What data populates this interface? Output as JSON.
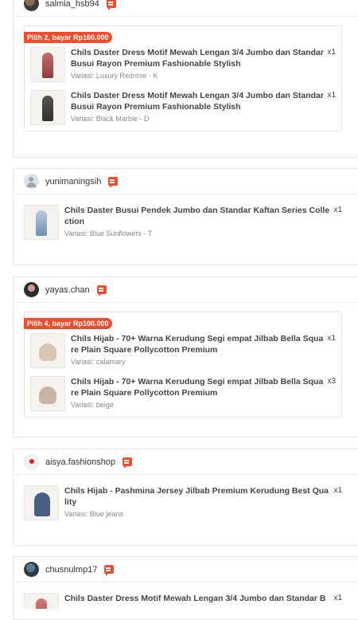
{
  "orders": [
    {
      "username": "salmia_hsb94",
      "promo": "Pilih 2, bayar Rp160.000",
      "items": [
        {
          "name": "Chils Daster Dress Motif Mewah Lengan 3/4 Jumbo dan Standar Busui Rayon Premium Fashionable Stylish",
          "variant": "Variasi: Luxury Redrose - K",
          "qty": "x1"
        },
        {
          "name": "Chils Daster Dress Motif Mewah Lengan 3/4 Jumbo dan Standar Busui Rayon Premium Fashionable Stylish",
          "variant": "Variasi: Black Marble - D",
          "qty": "x1"
        }
      ]
    },
    {
      "username": "yunimaningsih",
      "items": [
        {
          "name": "Chils Daster Busui Pendek Jumbo dan Standar Kaftan Series Collection",
          "variant": "Variasi: Blue Sunflowers - T",
          "qty": "x1"
        }
      ]
    },
    {
      "username": "yayas.chan",
      "promo": "Pilih 4, bayar Rp100.000",
      "items": [
        {
          "name": "Chils Hijab - 70+ Warna Kerudung Segi empat Jilbab Bella Square Plain Square Pollycotton Premium",
          "variant": "Variasi: calamary",
          "qty": "x1"
        },
        {
          "name": "Chils Hijab - 70+ Warna Kerudung Segi empat Jilbab Bella Square Plain Square Pollycotton Premium",
          "variant": "Variasi: beige",
          "qty": "x3"
        }
      ]
    },
    {
      "username": "aisya.fashionshop",
      "items": [
        {
          "name": "Chils Hijab - Pashmina Jersey Jilbab Premium Kerudung Best Quality",
          "variant": "Variasi: Blue jeans",
          "qty": "x1"
        }
      ]
    },
    {
      "username": "chusnulmp17",
      "items": [
        {
          "name": "Chils Daster Dress Motif Mewah Lengan 3/4 Jumbo dan Standar B",
          "qty": "x1"
        }
      ]
    }
  ],
  "icons": {
    "chat": "chat-icon",
    "avatar": "avatar"
  },
  "colors": {
    "accent": "#ee4d2d"
  }
}
